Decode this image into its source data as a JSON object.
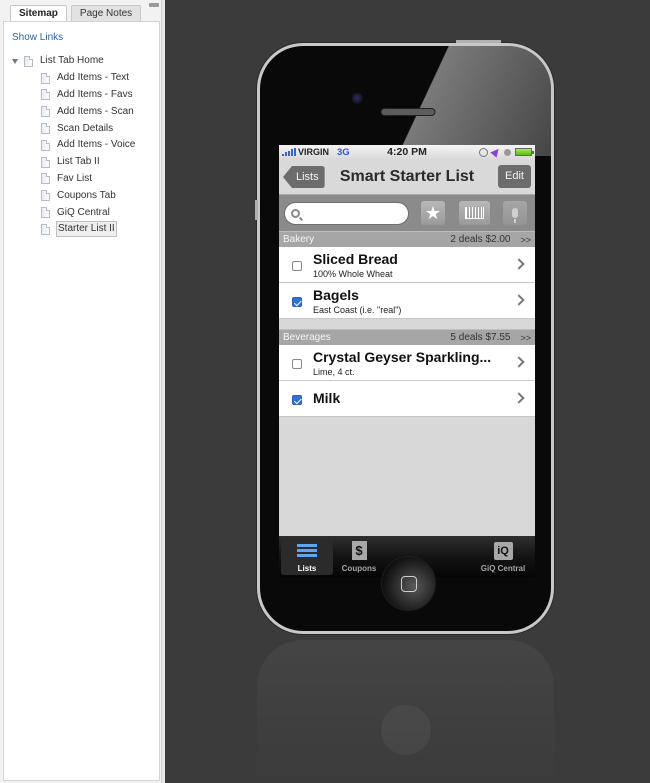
{
  "sidebar": {
    "tabs": [
      {
        "label": "Sitemap",
        "active": true
      },
      {
        "label": "Page Notes",
        "active": false
      }
    ],
    "show_links": "Show Links",
    "tree": {
      "root": "List Tab Home",
      "children": [
        "Add Items - Text",
        "Add Items - Favs",
        "Add Items - Scan",
        "Scan Details",
        "Add Items - Voice",
        "List Tab II",
        "Fav List",
        "Coupons Tab",
        "GiQ Central",
        "Starter List II"
      ],
      "selected": "Starter List II"
    }
  },
  "phone": {
    "status": {
      "carrier": "VIRGIN",
      "network": "3G",
      "time": "4:20 PM"
    },
    "navbar": {
      "back_label": "Lists",
      "title": "Smart Starter List",
      "edit_label": "Edit"
    },
    "search": {
      "placeholder": "",
      "value": ""
    },
    "toolbar_icons": [
      "star-icon",
      "barcode-icon",
      "microphone-icon"
    ],
    "sections": [
      {
        "name": "Bakery",
        "deals": "2 deals $2.00",
        "more": ">>",
        "items": [
          {
            "title": "Sliced Bread",
            "subtitle": "100% Whole Wheat",
            "checked": false
          },
          {
            "title": "Bagels",
            "subtitle": "East Coast (i.e. \"real\")",
            "checked": true
          }
        ]
      },
      {
        "name": "Beverages",
        "deals": "5 deals $7.55",
        "more": ">>",
        "items": [
          {
            "title": "Crystal Geyser Sparkling...",
            "subtitle": "Lime, 4 ct.",
            "checked": false
          },
          {
            "title": "Milk",
            "subtitle": "",
            "checked": true
          }
        ]
      }
    ],
    "tabbar": [
      {
        "label": "Lists",
        "icon": "lists-icon",
        "active": true
      },
      {
        "label": "Coupons",
        "icon": "coupon-icon",
        "glyph": "$",
        "active": false
      },
      {
        "label": "GiQ Central",
        "icon": "giq-icon",
        "glyph": "iQ",
        "active": false
      }
    ]
  }
}
